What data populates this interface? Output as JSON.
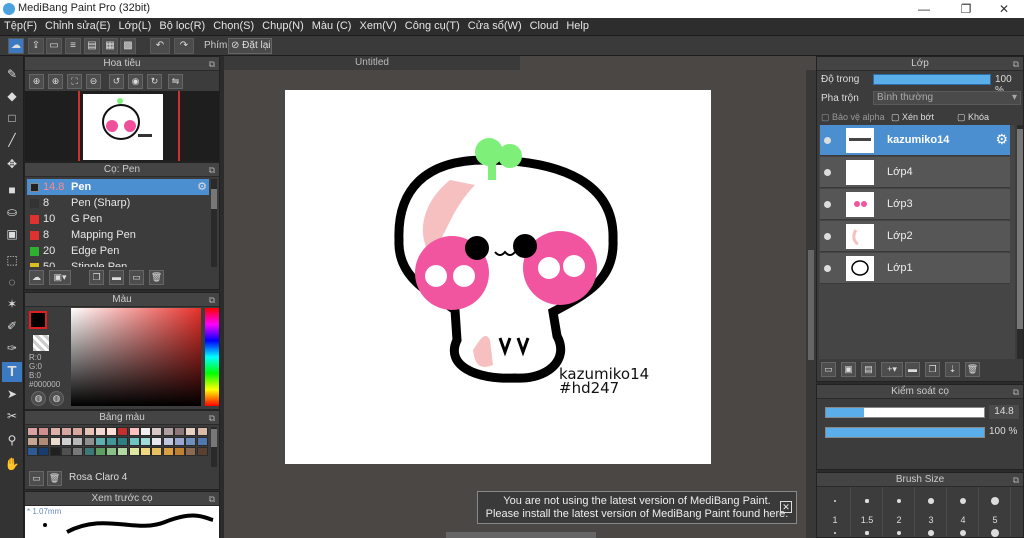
{
  "title": "MediBang Paint Pro (32bit)",
  "menu": [
    "Tệp(F)",
    "Chỉnh sửa(E)",
    "Lớp(L)",
    "Bộ lọc(R)",
    "Chọn(S)",
    "Chụp(N)",
    "Màu (C)",
    "Xem(V)",
    "Công cụ(T)",
    "Cửa sổ(W)",
    "Cloud",
    "Help"
  ],
  "toolbar": {
    "key_label": "Phím",
    "reset_label": "Đặt lại"
  },
  "navigator": {
    "title": "Hoa tiêu"
  },
  "brush": {
    "title": "Cọ: Pen",
    "items": [
      {
        "size": "14.8",
        "name": "Pen",
        "color": "#222222"
      },
      {
        "size": "8",
        "name": "Pen (Sharp)",
        "color": "#333333"
      },
      {
        "size": "10",
        "name": "G Pen",
        "color": "#e03030"
      },
      {
        "size": "8",
        "name": "Mapping Pen",
        "color": "#e03030"
      },
      {
        "size": "20",
        "name": "Edge Pen",
        "color": "#30b030"
      },
      {
        "size": "50",
        "name": "Stipple Pen",
        "color": "#d8c020"
      }
    ]
  },
  "color": {
    "title": "Màu",
    "r": "R:0",
    "g": "G:0",
    "b": "B:0",
    "hex": "#000000"
  },
  "palette": {
    "title": "Bảng màu",
    "selected": "Rosa Claro 4",
    "swatches": [
      "#d9a1a1",
      "#cf8f8f",
      "#e0b0a8",
      "#d6a6a0",
      "#d8a89e",
      "#e6c2b6",
      "#f2d6d0",
      "#ffe0d8",
      "#c23030",
      "#ffc0c0",
      "#f0f0f0",
      "#d8c8c8",
      "#b0a0a0",
      "#8c7878",
      "#e8d2c4",
      "#d8bca8",
      "#c6a690",
      "#b08c78",
      "#ecdcd0",
      "#d0d0d0",
      "#b8b8b8",
      "#909090",
      "#60b0b0",
      "#409898",
      "#2e8080",
      "#6fc4c4",
      "#a0dada",
      "#e8e8f0",
      "#c0c8e0",
      "#98a8d0",
      "#7090c0",
      "#5078b0",
      "#2c5a94",
      "#183c70",
      "#202020",
      "#505050",
      "#787878",
      "#3c7878",
      "#5e9e60",
      "#88c088",
      "#b0d8a0",
      "#e0e8a0",
      "#f0d880",
      "#e8c060",
      "#d8a040",
      "#c08030",
      "#8c6a50",
      "#5a4030"
    ]
  },
  "preview": {
    "title": "Xem trước cọ",
    "size": "1.07mm"
  },
  "doc": {
    "tab": "Untitled"
  },
  "art": {
    "line1": "kazumiko14",
    "line2": "#hd247"
  },
  "notice": {
    "line1": "You are not using the latest version of MediBang Paint.",
    "line2": "Please install the latest version of MediBang Paint found here."
  },
  "layers": {
    "title": "Lớp",
    "opacity_label": "Độ trong",
    "opacity_value": "100 %",
    "blend_label": "Pha trộn",
    "blend_value": "Bình thường",
    "alpha_label": "Bảo vệ alpha",
    "clip_label": "Xén bớt",
    "lock_label": "Khóa",
    "items": [
      {
        "name": "kazumiko14",
        "selected": true
      },
      {
        "name": "Lớp4"
      },
      {
        "name": "Lớp3"
      },
      {
        "name": "Lớp2"
      },
      {
        "name": "Lớp1"
      }
    ]
  },
  "brush_control": {
    "title": "Kiểm soát cọ",
    "size_value": "14.8",
    "opacity_value": "100 %",
    "size_fraction": 0.24,
    "opacity_fraction": 1.0
  },
  "brush_size": {
    "title": "Brush Size",
    "sizes": [
      "1",
      "1.5",
      "2",
      "3",
      "4",
      "5"
    ]
  }
}
